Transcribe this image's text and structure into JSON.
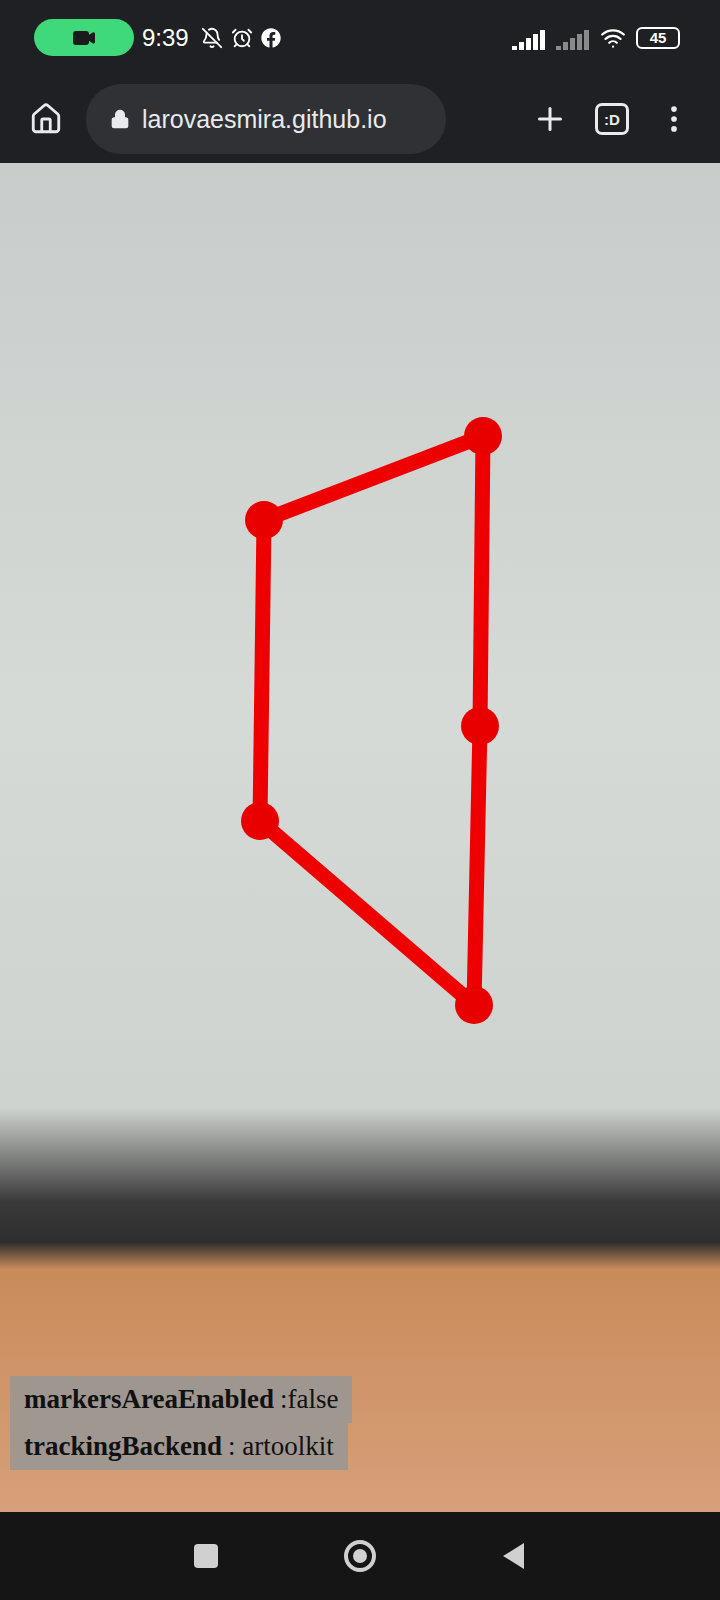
{
  "status_bar": {
    "time": "9:39",
    "battery": "45"
  },
  "browser": {
    "url": "larovaesmira.github.io",
    "tab_count": ":D"
  },
  "debug": [
    {
      "key": "markersAreaEnabled",
      "value": ":false"
    },
    {
      "key": "trackingBackend",
      "value": ": artoolkit"
    }
  ]
}
